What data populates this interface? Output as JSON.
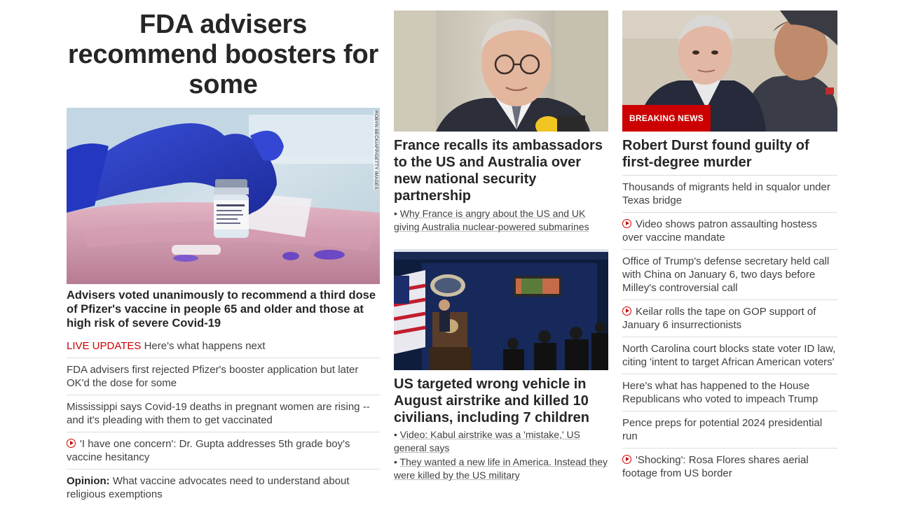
{
  "lead": {
    "headline": "FDA advisers recommend boosters for some",
    "image_credit": "ROBYN BECK/AFP/GETTY IMAGES",
    "subheadline": "Advisers voted unanimously to recommend a third dose of Pfizer's vaccine in people 65 and older and those at high risk of severe Covid-19",
    "items": [
      {
        "prefix": "LIVE UPDATES",
        "text": " Here's what happens next"
      },
      {
        "text": "FDA advisers first rejected Pfizer's booster application but later OK'd the dose for some"
      },
      {
        "text": "Mississippi says Covid-19 deaths in pregnant women are rising -- and it's pleading with them to get vaccinated"
      },
      {
        "video": true,
        "text": "'I have one concern': Dr. Gupta addresses 5th grade boy's vaccine hesitancy"
      },
      {
        "bold": "Opinion:",
        "text": " What vaccine advocates need to understand about religious exemptions"
      }
    ]
  },
  "france": {
    "headline": "France recalls its ambassadors to the US and Australia over new national security partnership",
    "bullet": "Why France is angry about the US and UK giving Australia nuclear-powered submarines"
  },
  "airstrike": {
    "headline": "US targeted wrong vehicle in August airstrike and killed 10 civilians, including 7 children",
    "bullets": [
      "Video: Kabul airstrike was a 'mistake,' US general says",
      "They wanted a new life in America. Instead they were killed by the US military"
    ]
  },
  "durst": {
    "badge": "BREAKING NEWS",
    "headline": "Robert Durst found guilty of first-degree murder",
    "items": [
      {
        "text": "Thousands of migrants held in squalor under Texas bridge"
      },
      {
        "video": true,
        "text": "Video shows patron assaulting hostess over vaccine mandate"
      },
      {
        "text": "Office of Trump's defense secretary held call with China on January 6, two days before Milley's controversial call"
      },
      {
        "video": true,
        "text": "Keilar rolls the tape on GOP support of January 6 insurrectionists"
      },
      {
        "text": "North Carolina court blocks state voter ID law, citing 'intent to target African American voters'"
      },
      {
        "text": "Here's what has happened to the House Republicans who voted to impeach Trump"
      },
      {
        "text": "Pence preps for potential 2024 presidential run"
      },
      {
        "video": true,
        "text": "'Shocking': Rosa Flores shares aerial footage from US border"
      }
    ]
  },
  "colors": {
    "accent": "#cc0000",
    "text": "#262626",
    "divider": "#dcdcdc"
  }
}
